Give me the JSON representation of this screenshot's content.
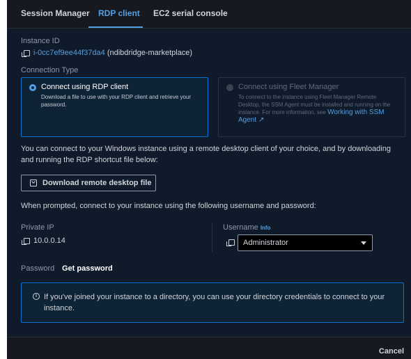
{
  "tabs": [
    {
      "label": "Session Manager",
      "active": false
    },
    {
      "label": "RDP client",
      "active": true
    },
    {
      "label": "EC2 serial console",
      "active": false
    }
  ],
  "instance": {
    "label": "Instance ID",
    "id": "i-0cc7ef9ee44f37da4",
    "name": "(ndibdridge-marketplace)"
  },
  "connection_type": {
    "label": "Connection Type",
    "options": [
      {
        "title": "Connect using RDP client",
        "description": "Download a file to use with your RDP client and retrieve your password.",
        "selected": true,
        "disabled": false
      },
      {
        "title": "Connect using Fleet Manager",
        "description": "To connect to the instance using Fleet Manager Remote Desktop, the SSM Agent must be installed and running on the instance. For more information, see",
        "link_text": "Working with SSM Agent",
        "selected": false,
        "disabled": true
      }
    ]
  },
  "intro_text": "You can connect to your Windows instance using a remote desktop client of your choice, and by downloading and running the RDP shortcut file below:",
  "download_button": "Download remote desktop file",
  "prompt_text": "When prompted, connect to your instance using the following username and password:",
  "private_ip": {
    "label": "Private IP",
    "value": "10.0.0.14"
  },
  "username": {
    "label": "Username",
    "info": "Info",
    "value": "Administrator"
  },
  "password": {
    "label": "Password",
    "action": "Get password"
  },
  "info_message": "If you've joined your instance to a directory, you can use your directory credentials to connect to your instance.",
  "footer": {
    "cancel": "Cancel"
  },
  "colors": {
    "accent": "#539fe5",
    "panel": "#0f1b2a",
    "header": "#16191f"
  }
}
